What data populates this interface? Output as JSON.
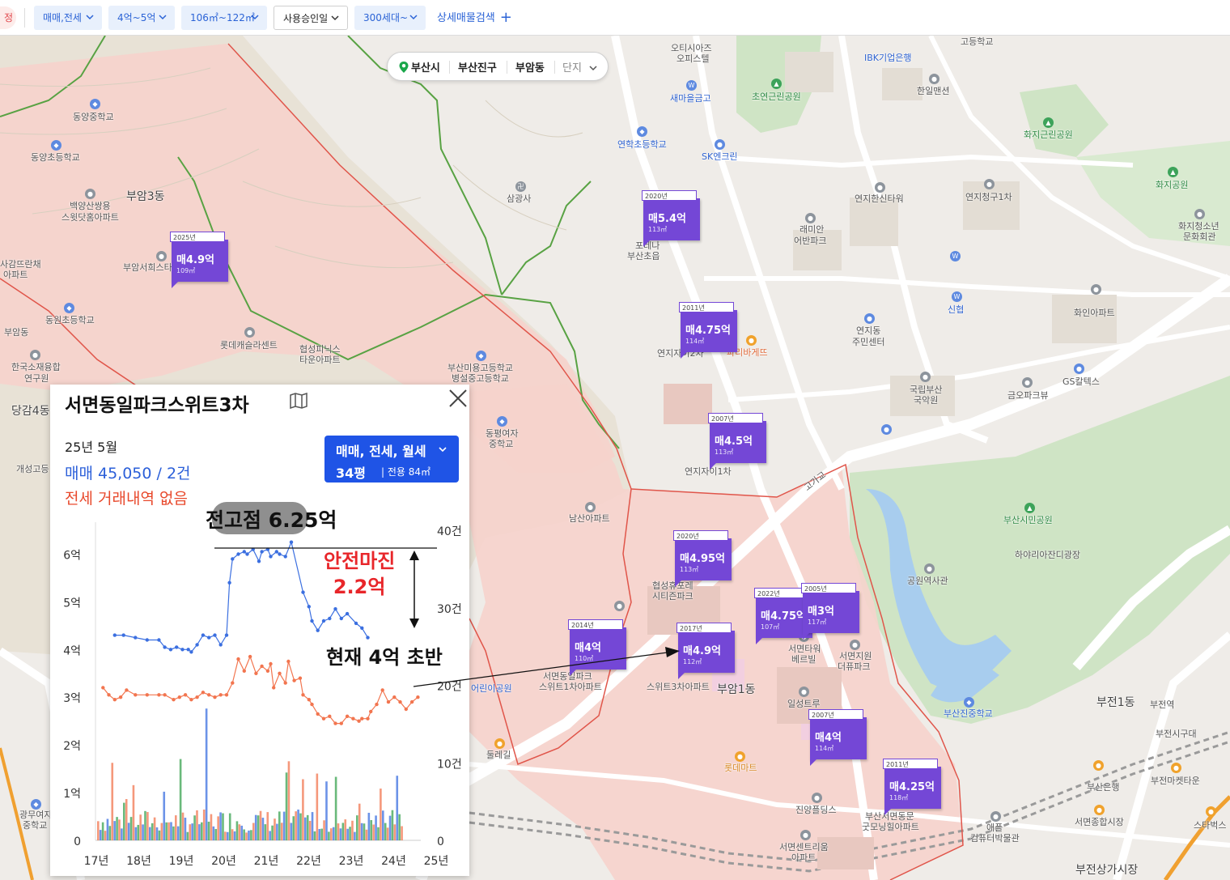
{
  "filters": {
    "reset_label": "정",
    "items": [
      {
        "label": "매매,전세"
      },
      {
        "label": "4억~5억"
      },
      {
        "label": "106㎡~122㎡"
      },
      {
        "label": "사용승인일"
      },
      {
        "label": "300세대~"
      }
    ],
    "advanced_label": "상세매물검색"
  },
  "breadcrumb": {
    "city": "부산시",
    "district": "부산진구",
    "dong": "부암동",
    "complex": "단지"
  },
  "map_labels": [
    {
      "text": "동양중학교"
    },
    {
      "text": "동양초등학교"
    },
    {
      "text": "부암3동"
    },
    {
      "text": "백양산쌍용"
    },
    {
      "text": "스윗닷홈아파트"
    },
    {
      "text": "부암서희스타"
    },
    {
      "text": "사감뜨란채"
    },
    {
      "text": "아파트"
    },
    {
      "text": "동원초등학교"
    },
    {
      "text": "롯데캐슬라센트"
    },
    {
      "text": "협성피닉스"
    },
    {
      "text": "타운아파트"
    },
    {
      "text": "한국소재융합"
    },
    {
      "text": "연구원"
    },
    {
      "text": "당감4동"
    },
    {
      "text": "개성고등"
    },
    {
      "text": "삼광사"
    },
    {
      "text": "오티시아즈"
    },
    {
      "text": "오피스텔"
    },
    {
      "text": "IBK기업은행"
    },
    {
      "text": "고등학교"
    },
    {
      "text": "새마을금고"
    },
    {
      "text": "초연근린공원"
    },
    {
      "text": "한일맨션"
    },
    {
      "text": "화지근린공원"
    },
    {
      "text": "연학초등학교"
    },
    {
      "text": "SK엔크린"
    },
    {
      "text": "화지공원"
    },
    {
      "text": "연지한신타워"
    },
    {
      "text": "연지청구1차"
    },
    {
      "text": "래미안"
    },
    {
      "text": "어반파크"
    },
    {
      "text": "포레나"
    },
    {
      "text": "부산초읍"
    },
    {
      "text": "화지청소년"
    },
    {
      "text": "문화회관"
    },
    {
      "text": "신협"
    },
    {
      "text": "연지동"
    },
    {
      "text": "주민센터"
    },
    {
      "text": "화인아파트"
    },
    {
      "text": "연지자이2차"
    },
    {
      "text": "파리바게뜨"
    },
    {
      "text": "국립부산"
    },
    {
      "text": "국악원"
    },
    {
      "text": "금오파크뷰"
    },
    {
      "text": "GS칼텍스"
    },
    {
      "text": "부산미용고등학교"
    },
    {
      "text": "병설중고등학교"
    },
    {
      "text": "동평여자"
    },
    {
      "text": "중학교"
    },
    {
      "text": "연지자이1차"
    },
    {
      "text": "남산아파트"
    },
    {
      "text": "고가교"
    },
    {
      "text": "부산시민공원"
    },
    {
      "text": "하야리아잔디광장"
    },
    {
      "text": "공원역사관"
    },
    {
      "text": "협성휴포레"
    },
    {
      "text": "시티즌파크"
    },
    {
      "text": "서면동일파크"
    },
    {
      "text": "스위트1차아파트"
    },
    {
      "text": "스위트3차아파트"
    },
    {
      "text": "부암1동"
    },
    {
      "text": "서면타워"
    },
    {
      "text": "베르빌"
    },
    {
      "text": "서면지원"
    },
    {
      "text": "더퓨파크"
    },
    {
      "text": "일성트루"
    },
    {
      "text": "부산진중학교"
    },
    {
      "text": "부전1동"
    },
    {
      "text": "부전역"
    },
    {
      "text": "부전시구대"
    },
    {
      "text": "둘레길"
    },
    {
      "text": "롯데마트"
    },
    {
      "text": "부산은행"
    },
    {
      "text": "부전마켓타운"
    },
    {
      "text": "진양플딩스"
    },
    {
      "text": "부산서면동문"
    },
    {
      "text": "굿모닝힐아파트"
    },
    {
      "text": "애플"
    },
    {
      "text": "컴퓨터박물관"
    },
    {
      "text": "서면종합시장"
    },
    {
      "text": "스타벅스"
    },
    {
      "text": "서면센트리움"
    },
    {
      "text": "아파트"
    },
    {
      "text": "부전상가시장"
    },
    {
      "text": "광무여자"
    },
    {
      "text": "중학교"
    },
    {
      "text": "어린이공원"
    },
    {
      "text": "부암동"
    }
  ],
  "markers": [
    {
      "year": "2025년",
      "price": "매4.9억",
      "area": "109㎡"
    },
    {
      "year": "2020년",
      "price": "매5.4억",
      "area": "113㎡"
    },
    {
      "year": "2011년",
      "price": "매4.75억",
      "area": "114㎡"
    },
    {
      "year": "2007년",
      "price": "매4.5억",
      "area": "113㎡"
    },
    {
      "year": "2020년",
      "price": "매4.95억",
      "area": "113㎡"
    },
    {
      "year": "2022년",
      "price": "매4.75억",
      "area": "107㎡"
    },
    {
      "year": "2005년",
      "price": "매3억",
      "area": "117㎡"
    },
    {
      "year": "2014년",
      "price": "매4억",
      "area": "110㎡"
    },
    {
      "year": "2017년",
      "price": "매4.9억",
      "area": "112㎡"
    },
    {
      "year": "2007년",
      "price": "매4억",
      "area": "114㎡"
    },
    {
      "year": "2011년",
      "price": "매4.25억",
      "area": "118㎡"
    }
  ],
  "panel": {
    "title": "서면동일파크스위트3차",
    "date": "25년 5월",
    "sale_summary": "매매 45,050 / 2건",
    "jeonse_summary": "전세 거래내역 없음",
    "type_selector": {
      "types": "매매, 전세, 월세",
      "pyeong": "34평",
      "exclusive": "전용 84㎡"
    }
  },
  "annotations": {
    "peak": "전고점 6.25억",
    "safe_line1": "안전마진",
    "safe_line2": "2.2억",
    "current": "현재 4억 초반"
  },
  "chart_data": {
    "type": "line",
    "x": [
      "17년",
      "18년",
      "19년",
      "20년",
      "21년",
      "22년",
      "23년",
      "24년",
      "25년"
    ],
    "y_left_ticks": [
      "0",
      "1억",
      "2억",
      "3억",
      "4억",
      "5억",
      "6억"
    ],
    "y_right_ticks": [
      "0",
      "10건",
      "20건",
      "30건",
      "40건"
    ],
    "ylim_left": [
      0,
      6.5
    ],
    "ylim_right": [
      0,
      40
    ],
    "series": [
      {
        "color": "#3b6fe0",
        "points": [
          [
            2017.6,
            4.3
          ],
          [
            2017.9,
            4.3
          ],
          [
            2018.3,
            4.25
          ],
          [
            2018.7,
            4.2
          ],
          [
            2019.1,
            4.2
          ],
          [
            2019.3,
            4.05
          ],
          [
            2019.5,
            4.0
          ],
          [
            2019.7,
            4.05
          ],
          [
            2019.9,
            4.0
          ],
          [
            2020.1,
            4.0
          ],
          [
            2020.2,
            3.95
          ],
          [
            2020.4,
            4.1
          ],
          [
            2020.6,
            4.3
          ],
          [
            2020.8,
            4.25
          ],
          [
            2021.0,
            4.3
          ],
          [
            2021.2,
            4.1
          ],
          [
            2021.4,
            4.3
          ],
          [
            2021.5,
            5.4
          ],
          [
            2021.6,
            5.9
          ],
          [
            2021.8,
            6.0
          ],
          [
            2022.0,
            6.05
          ],
          [
            2022.1,
            6.0
          ],
          [
            2022.3,
            6.1
          ],
          [
            2022.5,
            5.85
          ],
          [
            2022.6,
            6.05
          ],
          [
            2022.8,
            6.1
          ],
          [
            2022.9,
            5.95
          ],
          [
            2023.1,
            6.05
          ],
          [
            2023.2,
            6.0
          ],
          [
            2023.4,
            5.95
          ],
          [
            2023.6,
            6.25
          ],
          [
            2024.0,
            5.2
          ],
          [
            2024.2,
            4.9
          ],
          [
            2024.3,
            4.6
          ],
          [
            2024.5,
            4.4
          ],
          [
            2024.7,
            4.6
          ],
          [
            2024.9,
            4.65
          ],
          [
            2025.1,
            4.85
          ],
          [
            2025.3,
            4.65
          ],
          [
            2025.5,
            4.75
          ],
          [
            2025.8,
            4.55
          ],
          [
            2026.0,
            4.45
          ],
          [
            2026.2,
            4.25
          ]
        ]
      },
      {
        "color": "#f2754f",
        "points": [
          [
            2017.2,
            3.2
          ],
          [
            2017.4,
            3.05
          ],
          [
            2017.6,
            2.95
          ],
          [
            2017.8,
            3.0
          ],
          [
            2018.0,
            3.15
          ],
          [
            2018.3,
            3.05
          ],
          [
            2018.7,
            3.05
          ],
          [
            2019.1,
            3.05
          ],
          [
            2019.3,
            3.05
          ],
          [
            2019.6,
            2.95
          ],
          [
            2019.8,
            3.0
          ],
          [
            2020.0,
            3.05
          ],
          [
            2020.2,
            2.95
          ],
          [
            2020.4,
            3.0
          ],
          [
            2020.6,
            3.1
          ],
          [
            2020.8,
            3.05
          ],
          [
            2021.0,
            3.0
          ],
          [
            2021.2,
            3.05
          ],
          [
            2021.4,
            3.05
          ],
          [
            2021.6,
            3.3
          ],
          [
            2021.8,
            3.8
          ],
          [
            2022.0,
            3.55
          ],
          [
            2022.2,
            3.85
          ],
          [
            2022.4,
            3.5
          ],
          [
            2022.6,
            3.65
          ],
          [
            2022.8,
            3.55
          ],
          [
            2022.9,
            3.7
          ],
          [
            2023.0,
            3.2
          ],
          [
            2023.2,
            3.5
          ],
          [
            2023.4,
            3.3
          ],
          [
            2023.5,
            3.75
          ],
          [
            2023.7,
            3.35
          ],
          [
            2023.9,
            3.4
          ],
          [
            2024.0,
            3.05
          ],
          [
            2024.2,
            2.95
          ],
          [
            2024.3,
            2.85
          ],
          [
            2024.5,
            2.65
          ],
          [
            2024.7,
            2.55
          ],
          [
            2024.9,
            2.6
          ],
          [
            2025.1,
            2.45
          ],
          [
            2025.3,
            2.45
          ],
          [
            2025.5,
            2.6
          ],
          [
            2025.7,
            2.55
          ],
          [
            2025.9,
            2.5
          ],
          [
            2026.0,
            2.55
          ],
          [
            2026.2,
            2.55
          ],
          [
            2026.3,
            2.7
          ],
          [
            2026.5,
            2.85
          ],
          [
            2026.7,
            3.15
          ],
          [
            2026.9,
            2.9
          ],
          [
            2027.1,
            3.0
          ],
          [
            2027.3,
            2.9
          ],
          [
            2027.5,
            2.75
          ],
          [
            2027.7,
            2.9
          ],
          [
            2027.9,
            3.0
          ]
        ]
      }
    ],
    "volume_colors": [
      "#f2754f",
      "#3b6fe0",
      "#38a24f"
    ]
  }
}
